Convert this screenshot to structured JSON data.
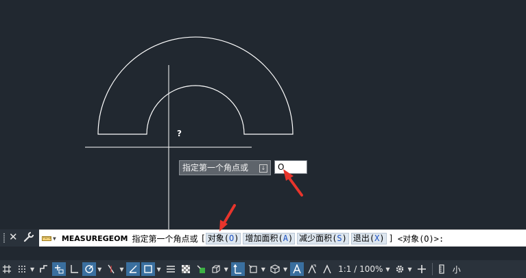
{
  "canvas": {
    "cursor_hint": "?"
  },
  "dynamic_input": {
    "prompt": "指定第一个角点或",
    "value": "O"
  },
  "command_line": {
    "command": "MEASUREGEOM",
    "prompt": "指定第一个角点或",
    "bracket_open": "[",
    "bracket_close": "]",
    "options": [
      {
        "label": "对象",
        "key": "O"
      },
      {
        "label": "增加面积",
        "key": "A"
      },
      {
        "label": "减少面积",
        "key": "S"
      },
      {
        "label": "退出",
        "key": "X"
      }
    ],
    "default": "<对象(O)>:"
  },
  "status_bar": {
    "scale": "1:1 / 100%",
    "trailing": "小"
  },
  "colors": {
    "background": "#212830",
    "geometry": "#ffffff",
    "arrow": "#e8352c",
    "active_toggle": "#3a6f9f"
  }
}
